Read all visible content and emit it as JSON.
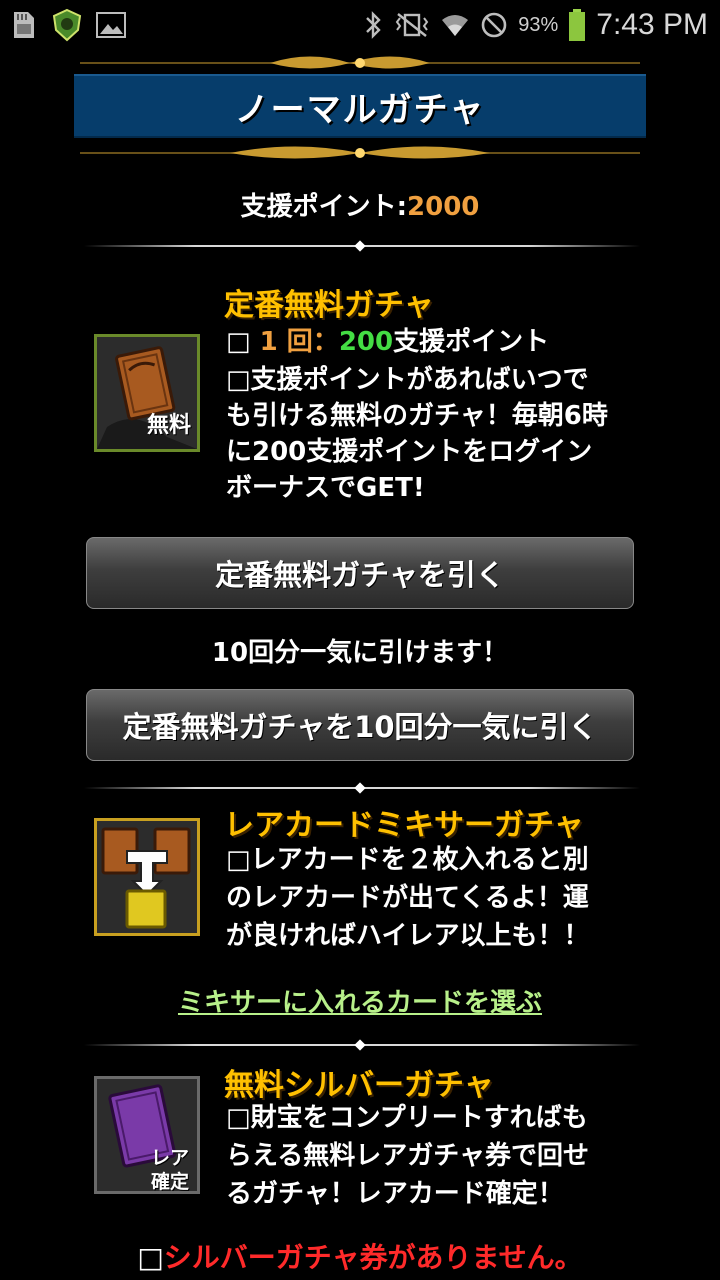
{
  "status_bar": {
    "battery_percent": "93%",
    "time": "7:43 PM",
    "icons": [
      "sd-card-icon",
      "app-shield-icon",
      "gallery-icon",
      "bluetooth-icon",
      "vibrate-icon",
      "wifi-icon",
      "no-disturb-icon",
      "battery-icon"
    ]
  },
  "header": {
    "title": "ノーマルガチャ"
  },
  "points": {
    "label": "支援ポイント:",
    "value": "2000"
  },
  "free_gacha": {
    "title": "定番無料ガチャ",
    "cost_box": "□",
    "cost_count": "1 回",
    "cost_sep": "：",
    "cost_points": "200",
    "cost_unit": "支援ポイント",
    "desc_line1": "□支援ポイントがあればいつで",
    "desc_line2": "も引ける無料のガチャ！毎朝6時",
    "desc_line3": "に200支援ポイントをログイン",
    "desc_line4": "ボーナスでGET!",
    "icon_label": "無料",
    "button_label": "定番無料ガチャを引く",
    "multi_caption": "10回分一気に引けます！",
    "multi_button_label": "定番無料ガチャを10回分一気に引く"
  },
  "mixer_gacha": {
    "title": "レアカードミキサーガチャ",
    "desc_line1": "□レアカードを２枚入れると別",
    "desc_line2": "のレアカードが出てくるよ！運",
    "desc_line3": "が良ければハイレア以上も！！",
    "link_label": "ミキサーに入れるカードを選ぶ"
  },
  "silver_gacha": {
    "title": "無料シルバーガチャ",
    "desc_line1": "□財宝をコンプリートすればも",
    "desc_line2": "らえる無料レアガチャ券で回せ",
    "desc_line3": "るガチャ！レアカード確定！",
    "icon_label_1": "レア",
    "icon_label_2": "確定",
    "warning_box": "□",
    "warning_text": "シルバーガチャ券がありません。"
  },
  "colors": {
    "title_bar": "#063d6b",
    "section_title": "#ffc000",
    "points_value": "#f0a040",
    "cost_points": "#44dd44",
    "link": "#b8f08a",
    "warning": "#ff2a2a"
  }
}
